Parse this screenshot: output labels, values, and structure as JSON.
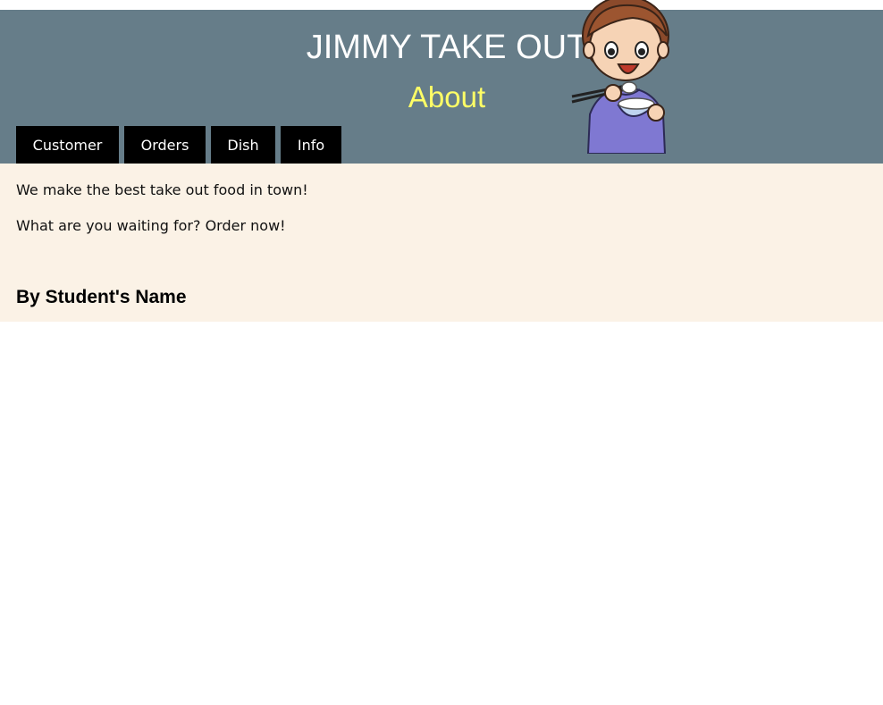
{
  "header": {
    "site_title": "JIMMY TAKE OUT",
    "page_title": "About",
    "mascot_icon": "boy-eating-rice-icon"
  },
  "nav": {
    "items": [
      {
        "label": "Customer"
      },
      {
        "label": "Orders"
      },
      {
        "label": "Dish"
      },
      {
        "label": "Info"
      }
    ]
  },
  "main": {
    "paragraphs": [
      "We make the best take out food in town!",
      "What are you waiting for? Order now!"
    ],
    "author": "By Student's Name"
  },
  "colors": {
    "header_bg": "#667d89",
    "title_color": "#ffffff",
    "subtitle_color": "#ffff66",
    "nav_bg": "#000000",
    "content_bg": "#fbf2e6"
  }
}
